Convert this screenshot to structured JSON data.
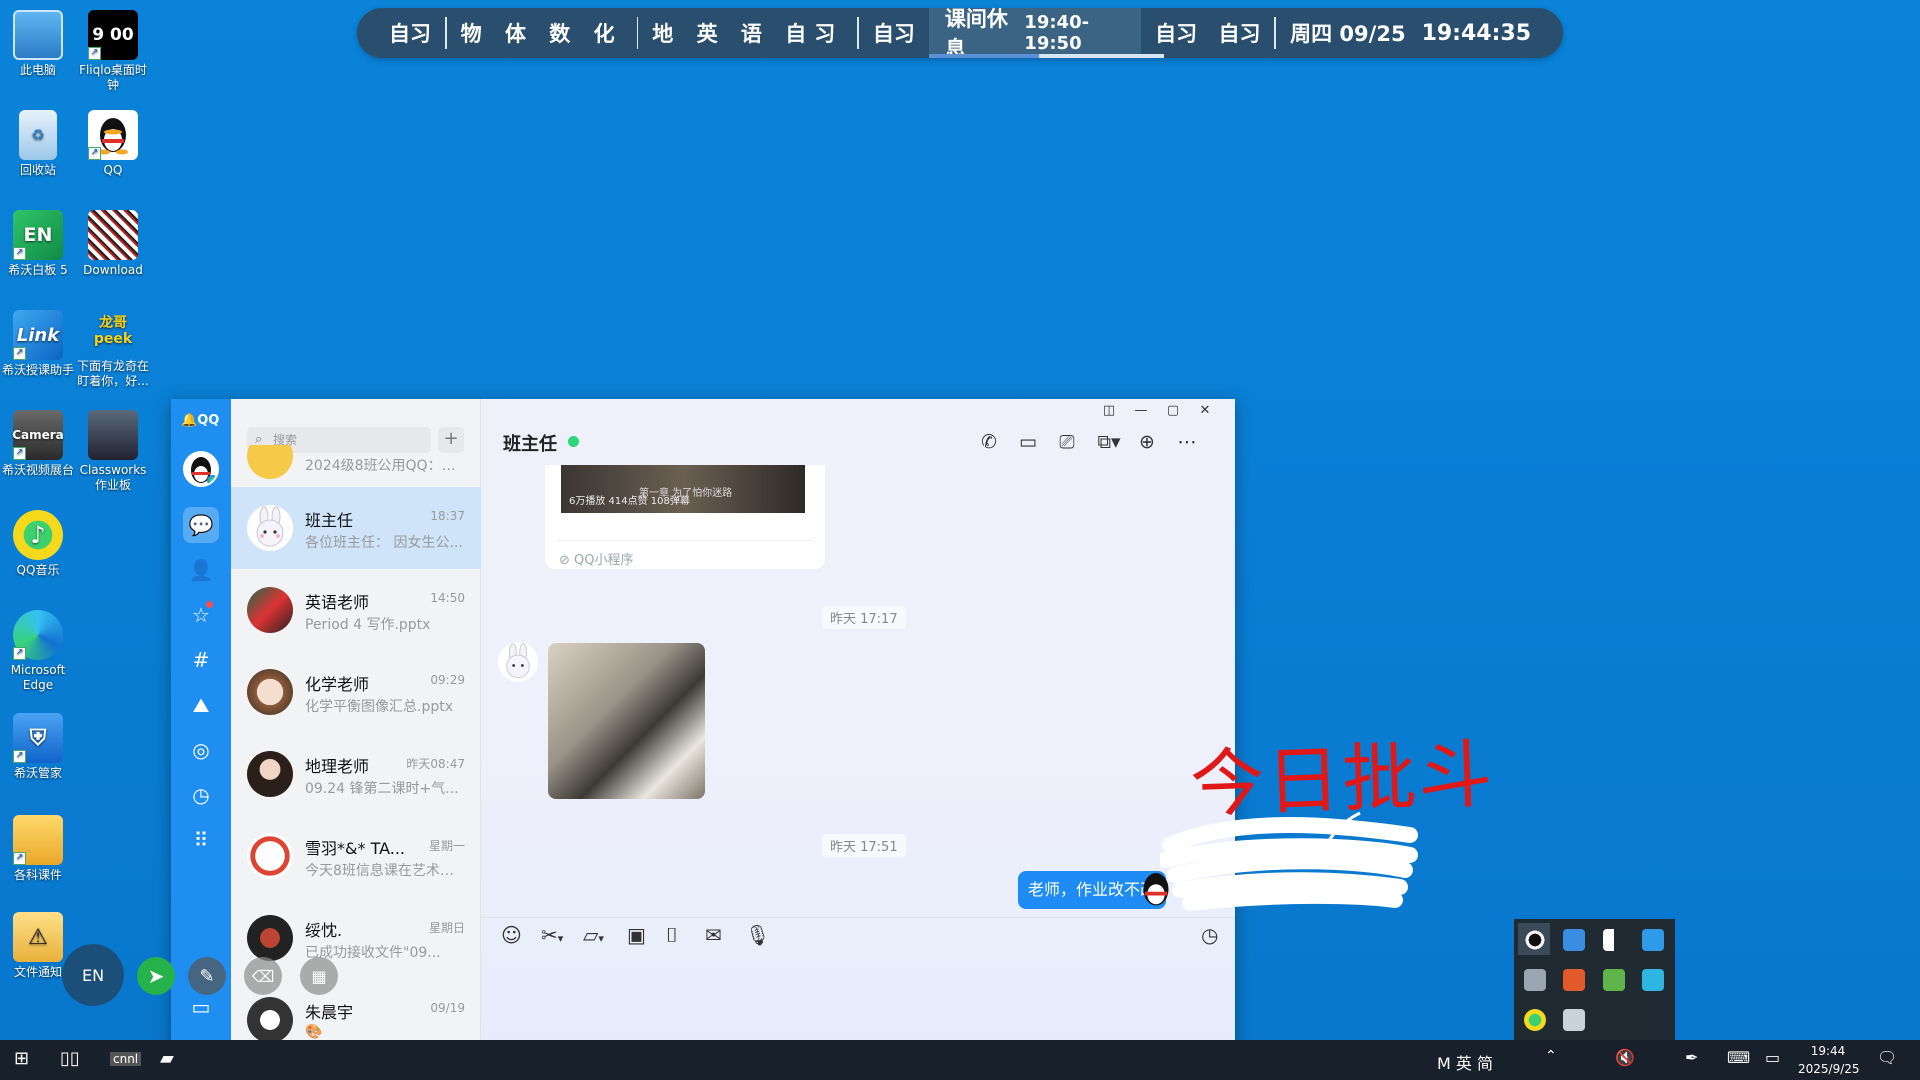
{
  "schedule": {
    "s1": "自习",
    "s2": "物 体 数 化",
    "s3": "地 英 语 自习",
    "s4": "自习",
    "current_label": "课间休息",
    "current_time": "19:40-19:50",
    "s5": "自习 自习",
    "date": "周四 09/25",
    "clock": "19:44:35"
  },
  "desktop": {
    "icons": [
      {
        "label": "此电脑"
      },
      {
        "label": "Fliqlo桌面时钟",
        "img_text": "9 00"
      },
      {
        "label": "回收站"
      },
      {
        "label": "QQ"
      },
      {
        "label": "希沃白板 5",
        "img_text": "EN"
      },
      {
        "label": "Download"
      },
      {
        "label": "希沃授课助手",
        "img_text": "Link"
      },
      {
        "label": "下面有龙奇在盯着你，好...",
        "img_text": "龙哥 peek"
      },
      {
        "label": "希沃视频展台",
        "img_text": "Camera"
      },
      {
        "label": "Classworks 作业板"
      },
      {
        "label": "QQ音乐"
      },
      {
        "label": "Microsoft Edge"
      },
      {
        "label": "希沃管家"
      },
      {
        "label": "各科课件"
      },
      {
        "label": "文件通知"
      }
    ]
  },
  "qq": {
    "logo": "QQ",
    "search_placeholder": "搜索",
    "plus": "+",
    "chats": [
      {
        "name": "",
        "time": "",
        "preview": "2024级8班公用QQ：作..."
      },
      {
        "name": "班主任",
        "time": "18:37",
        "preview": "各位班主任： 因女生公..."
      },
      {
        "name": "英语老师",
        "time": "14:50",
        "preview": "Period 4 写作.pptx"
      },
      {
        "name": "化学老师",
        "time": "09:29",
        "preview": "化学平衡图像汇总.pptx"
      },
      {
        "name": "地理老师",
        "time": "昨天08:47",
        "preview": "09.24 锋第二课时+气..."
      },
      {
        "name": "雪羽*&* TA...",
        "time": "星期一",
        "preview": "今天8班信息课在艺术楼..."
      },
      {
        "name": "绥忱.",
        "time": "星期日",
        "preview": "已成功接收文件\"09..."
      },
      {
        "name": "朱晨宇",
        "time": "09/19",
        "preview": ""
      }
    ],
    "conversation": {
      "title": "班主任",
      "video_stats": "6万播放 414点赞 108弹幕",
      "video_caption": "第一章 为了怕你迷路",
      "mini_program": "QQ小程序",
      "ts1": "昨天 17:17",
      "ts2": "昨天 17:51",
      "sent_message": "老师，作业改不改"
    }
  },
  "overlay": {
    "ink_text": "今日批斗"
  },
  "taskbar": {
    "ime": "M 英 简",
    "time": "19:44",
    "date": "2025/9/25"
  },
  "colors": {
    "desktop_bg": "#0a80d7",
    "qq_rail": "#1e8ff0",
    "bubble": "#1f8cf5",
    "ink": "#e01818",
    "schedule_bg": "#2a4f6e"
  }
}
